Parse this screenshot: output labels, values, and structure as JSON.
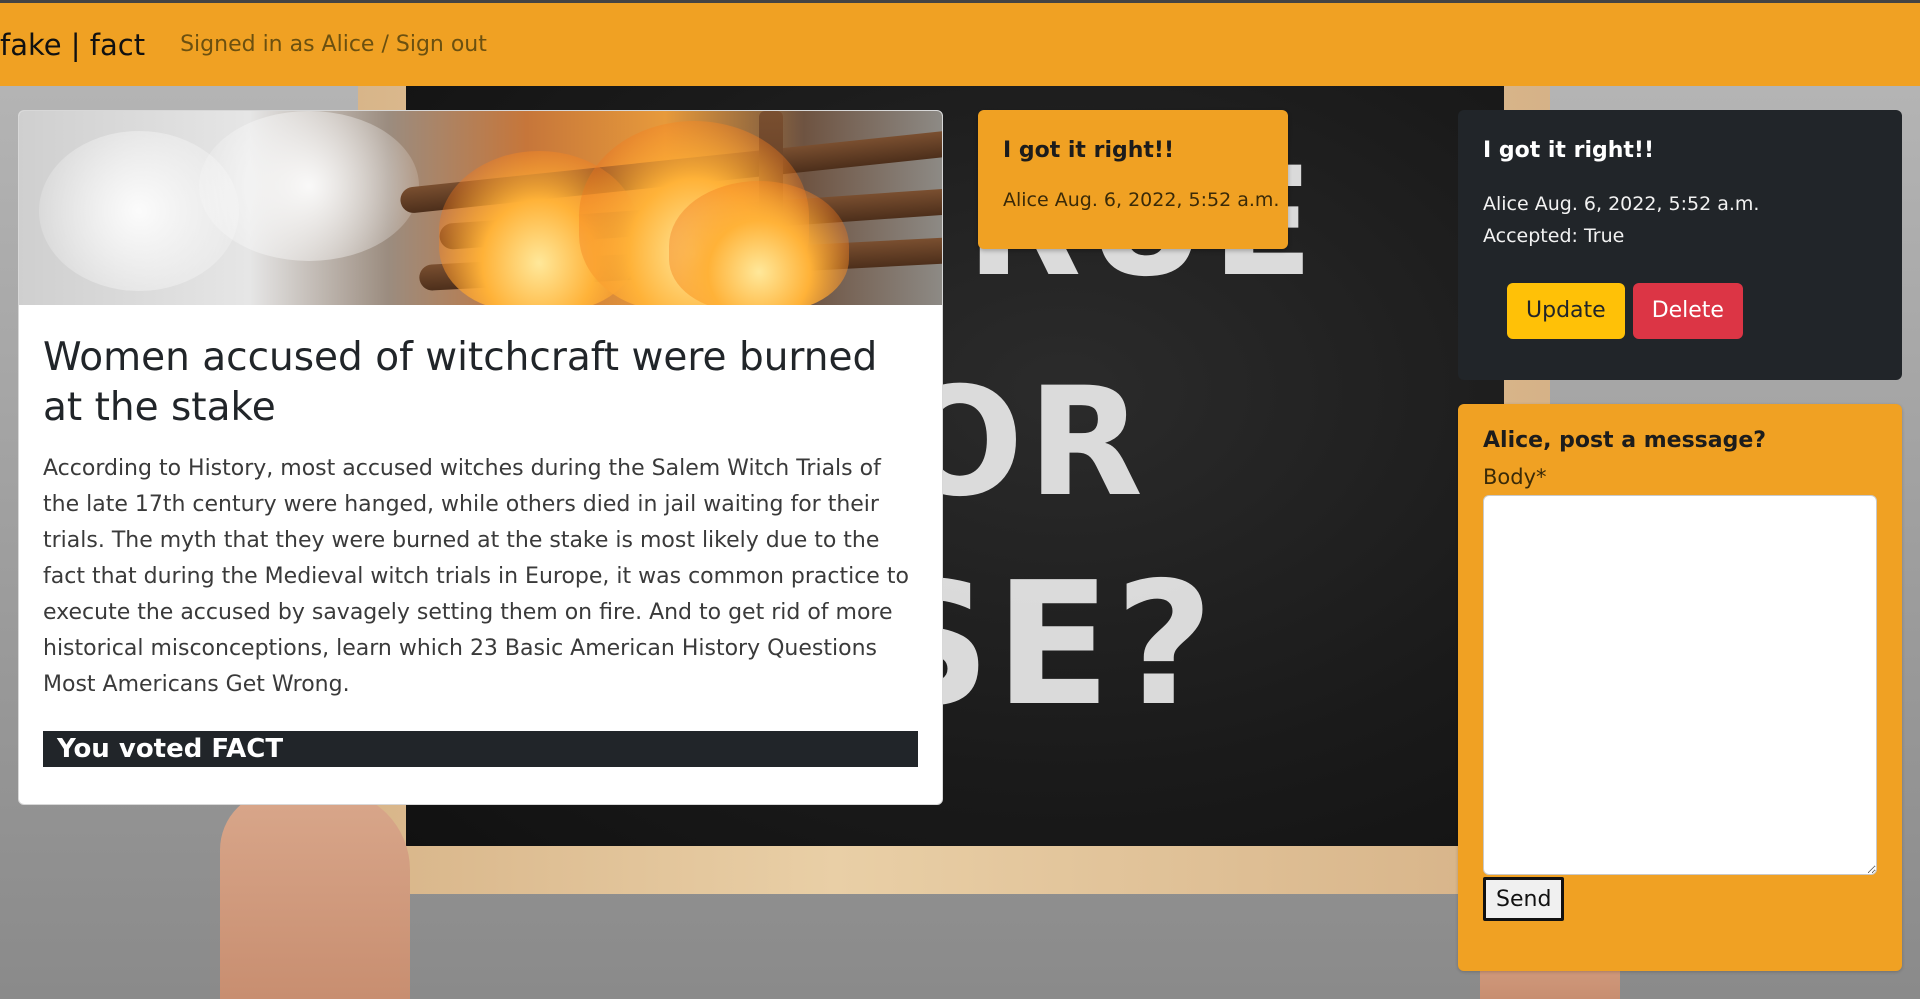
{
  "nav": {
    "brand": "fake | fact",
    "user_status": "Signed in as Alice / Sign out"
  },
  "background": {
    "words": [
      "RUE",
      "OR",
      "LSE?"
    ]
  },
  "fact_card": {
    "title": "Women accused of witchcraft were burned at the stake",
    "body": "According to History, most accused witches during the Salem Witch Trials of the late 17th century were hanged, while others died in jail waiting for their trials. The myth that they were burned at the stake is most likely due to the fact that during the Medieval witch trials in Europe, it was common practice to execute the accused by savagely setting them on fire. And to get rid of more historical misconceptions, learn which 23 Basic American History Questions Most Americans Get Wrong.",
    "vote_status": "You voted FACT"
  },
  "message_orange": {
    "title": "I got it right!!",
    "meta": "Alice Aug. 6, 2022, 5:52 a.m."
  },
  "message_dark": {
    "title": "I got it right!!",
    "meta": "Alice Aug. 6, 2022, 5:52 a.m.",
    "accepted": "Accepted: True",
    "update_label": "Update",
    "delete_label": "Delete"
  },
  "post_form": {
    "title": "Alice, post a message?",
    "body_label": "Body*",
    "body_value": "",
    "send_label": "Send"
  },
  "colors": {
    "navbar": "#f0a123",
    "dark_card": "#212529",
    "update_button": "#ffc107",
    "delete_button": "#dc3545"
  }
}
